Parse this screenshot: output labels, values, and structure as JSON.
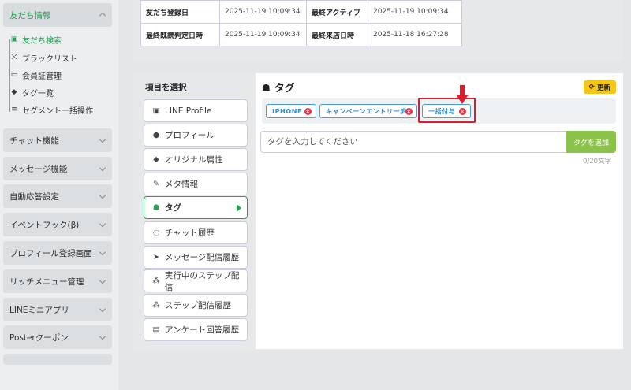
{
  "sidebar": {
    "open_category": "友だち情報",
    "sub_items": [
      {
        "label": "友だち検索",
        "icon": "id-card-icon"
      },
      {
        "label": "ブラックリスト",
        "icon": "user-slash-icon"
      },
      {
        "label": "会員証管理",
        "icon": "card-icon"
      },
      {
        "label": "タグ一覧",
        "icon": "tag-icon"
      },
      {
        "label": "セグメント一括操作",
        "icon": "database-icon"
      }
    ],
    "categories": [
      "チャット機能",
      "メッセージ機能",
      "自動応答設定",
      "イベントフック(β)",
      "プロフィール登録画面",
      "リッチメニュー管理",
      "LINEミニアプリ",
      "Posterクーポン"
    ]
  },
  "info": {
    "rows": [
      {
        "k1": "友だち登録日",
        "v1": "2025-11-19 10:09:34",
        "k2": "最終アクティブ",
        "v2": "2025-11-19 10:09:34"
      },
      {
        "k1": "最終既読判定日時",
        "v1": "2025-11-19 10:09:34",
        "k2": "最終来店日時",
        "v2": "2025-11-18 16:27:28"
      }
    ]
  },
  "menu": {
    "title": "項目を選択",
    "items": [
      {
        "label": "LINE Profile",
        "icon": "line-icon"
      },
      {
        "label": "プロフィール",
        "icon": "user-circle-icon"
      },
      {
        "label": "オリジナル属性",
        "icon": "tags-icon"
      },
      {
        "label": "メタ情報",
        "icon": "magic-icon"
      },
      {
        "label": "タグ",
        "icon": "user-tag-icon"
      },
      {
        "label": "チャット履歴",
        "icon": "comments-icon"
      },
      {
        "label": "メッセージ配信履歴",
        "icon": "send-icon"
      },
      {
        "label": "実行中のステップ配信",
        "icon": "steps-icon"
      },
      {
        "label": "ステップ配信履歴",
        "icon": "steps-icon"
      },
      {
        "label": "アンケート回答履歴",
        "icon": "survey-icon"
      }
    ]
  },
  "content": {
    "title": "タグ",
    "refresh_label": "更新",
    "tags": [
      "IPHONE",
      "キャンペーンエントリー済",
      "一括付与"
    ],
    "input_placeholder": "タグを入力してください",
    "add_label": "タグを追加",
    "char_count": "0/20文字"
  },
  "colors": {
    "accent": "#2a9d56",
    "tag_blue": "#2d8fcf",
    "highlight_red": "#d6202e",
    "add_green": "#8bc34a",
    "refresh_yellow": "#f5c518"
  }
}
